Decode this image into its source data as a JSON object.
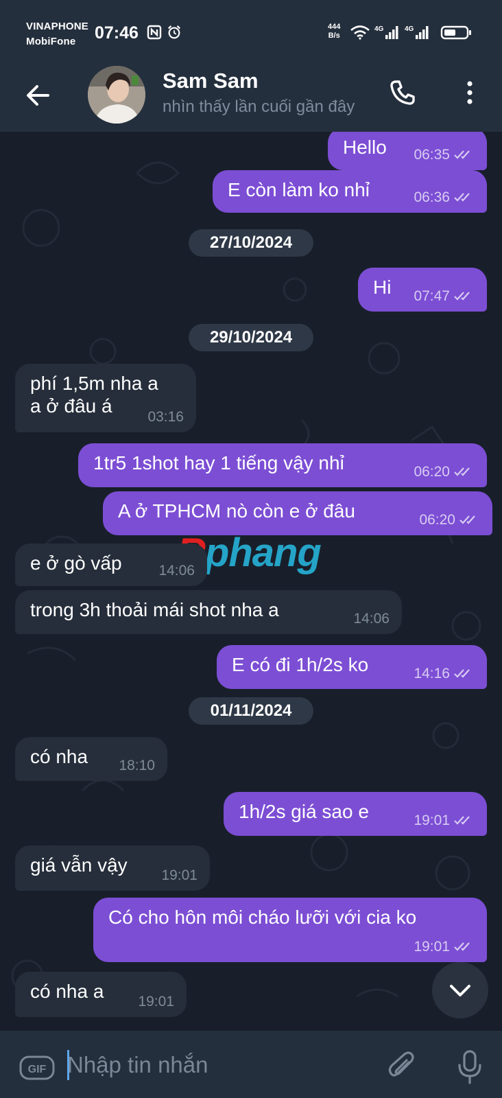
{
  "status_bar": {
    "carrier1": "VINAPHONE",
    "carrier2": "MobiFone",
    "time": "07:46",
    "net_speed_value": "444",
    "net_speed_unit": "B/s",
    "icons": [
      "nfc-icon",
      "alarm-icon",
      "wifi-icon",
      "signal-4g-icon",
      "signal-4g-icon",
      "battery-icon"
    ]
  },
  "header": {
    "contact_name": "Sam Sam",
    "contact_status": "nhìn thấy lần cuối gần đây",
    "icons": [
      "back-arrow-icon",
      "phone-icon",
      "more-vertical-icon"
    ]
  },
  "messages": [
    {
      "dir": "out",
      "text": "Hello",
      "time": "06:35",
      "read": true
    },
    {
      "dir": "out",
      "text": "E còn làm ko nhỉ",
      "time": "06:36",
      "read": true
    },
    {
      "type": "date",
      "text": "27/10/2024"
    },
    {
      "dir": "out",
      "text": "Hi",
      "time": "07:47",
      "read": true
    },
    {
      "type": "date",
      "text": "29/10/2024"
    },
    {
      "dir": "in",
      "text": "phí 1,5m nha a",
      "text2": "a ở đâu á",
      "time": "03:16"
    },
    {
      "dir": "out",
      "text": "1tr5 1shot hay 1 tiếng vậy nhỉ",
      "time": "06:20",
      "read": true
    },
    {
      "dir": "out",
      "text": "A ở TPHCM nò còn e ở đâu",
      "time": "06:20",
      "read": true
    },
    {
      "dir": "in",
      "text": "e ở gò vấp",
      "time": "14:06"
    },
    {
      "dir": "in",
      "text": "trong 3h thoải mái shot nha a",
      "time": "14:06"
    },
    {
      "dir": "out",
      "text": "E có đi 1h/2s ko",
      "time": "14:16",
      "read": true
    },
    {
      "type": "date",
      "text": "01/11/2024"
    },
    {
      "dir": "in",
      "text": "có nha",
      "time": "18:10"
    },
    {
      "dir": "out",
      "text": "1h/2s giá sao e",
      "time": "19:01",
      "read": true
    },
    {
      "dir": "in",
      "text": "giá vẫn vậy",
      "time": "19:01"
    },
    {
      "dir": "out",
      "text": "Có cho hôn môi cháo lưỡi với cia ko",
      "time": "19:01",
      "read": true
    },
    {
      "dir": "in",
      "text": "có nha a",
      "time": "19:01"
    }
  ],
  "watermark": {
    "first": "R",
    "rest": "phang"
  },
  "composer": {
    "placeholder": "Nhập tin nhắn",
    "value": "",
    "gif_label": "GIF",
    "icons": [
      "attach-icon",
      "microphone-icon",
      "chevron-down-icon"
    ]
  },
  "colors": {
    "background": "#181f2a",
    "header": "#242f3d",
    "outgoing_bubble": "#7c4ed4",
    "incoming_bubble": "#262e3b",
    "date_chip": "#2e3846"
  }
}
